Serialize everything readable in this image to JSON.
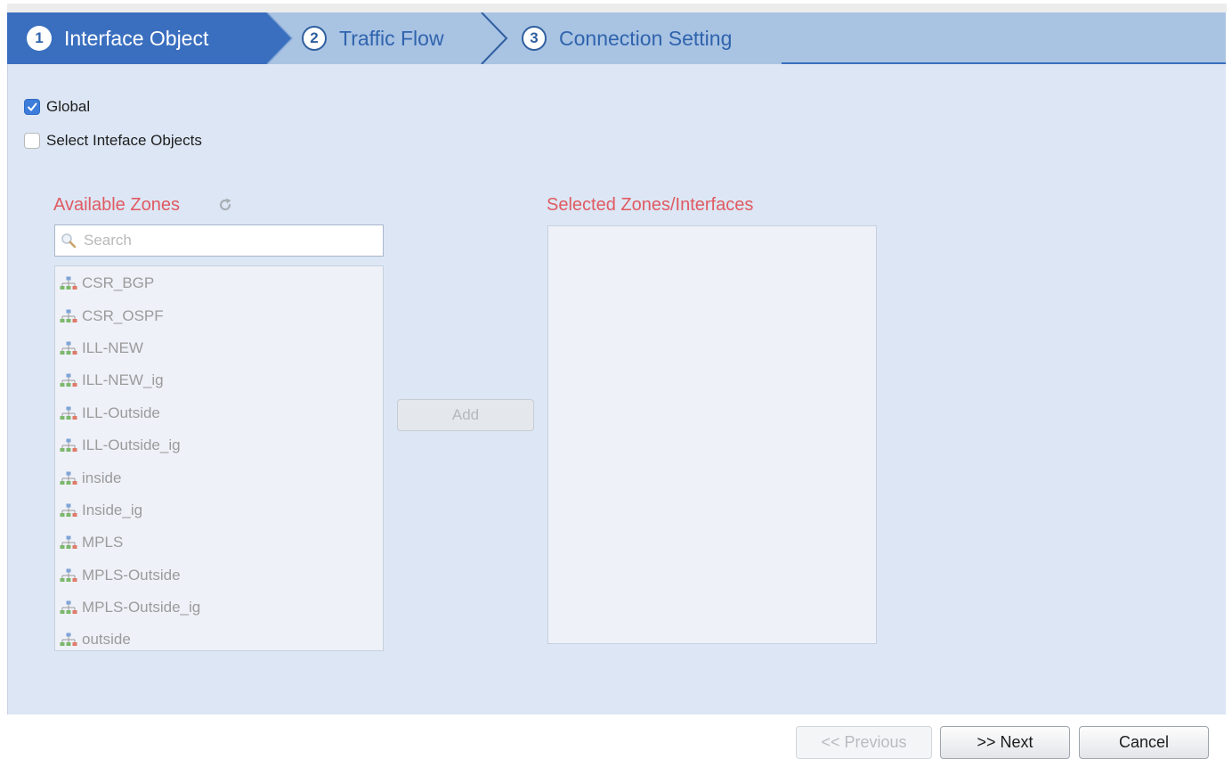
{
  "wizard": {
    "steps": [
      {
        "number": "1",
        "label": "Interface Object",
        "state": "active"
      },
      {
        "number": "2",
        "label": "Traffic Flow",
        "state": "inactive"
      },
      {
        "number": "3",
        "label": "Connection Setting",
        "state": "inactive"
      }
    ]
  },
  "options": {
    "global": {
      "label": "Global",
      "checked": true
    },
    "select_objects": {
      "label": "Select Inteface Objects",
      "checked": false
    }
  },
  "available_zones": {
    "title": "Available Zones",
    "refresh_icon": "refresh-icon",
    "search_placeholder": "Search",
    "search_value": "",
    "item_icon": "network-zone-icon",
    "items": [
      "CSR_BGP",
      "CSR_OSPF",
      "ILL-NEW",
      "ILL-NEW_ig",
      "ILL-Outside",
      "ILL-Outside_ig",
      "inside",
      "Inside_ig",
      "MPLS",
      "MPLS-Outside",
      "MPLS-Outside_ig",
      "outside"
    ]
  },
  "add_button": {
    "label": "Add",
    "enabled": false
  },
  "selected_zones": {
    "title": "Selected Zones/Interfaces",
    "items": []
  },
  "footer": {
    "previous_label": "<< Previous",
    "next_label": ">> Next",
    "cancel_label": "Cancel"
  },
  "colors": {
    "active_step": "#3a6fbf",
    "step_bar": "#a9c3e3",
    "panel_bg": "#dce6f4",
    "section_title": "#e05a62",
    "checkbox_checked": "#3c7ddb"
  }
}
